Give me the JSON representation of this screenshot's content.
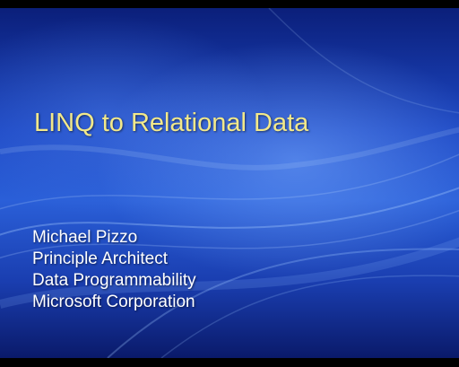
{
  "slide": {
    "title": "LINQ to Relational Data",
    "presenter": {
      "name": "Michael Pizzo",
      "role": "Principle Architect",
      "team": "Data Programmability",
      "company": "Microsoft Corporation"
    }
  },
  "colors": {
    "background_top": "#0b1f7a",
    "background_mid": "#2a5fd8",
    "title_color": "#f2e88a",
    "text_color": "#ffffff",
    "letterbox": "#000000"
  }
}
